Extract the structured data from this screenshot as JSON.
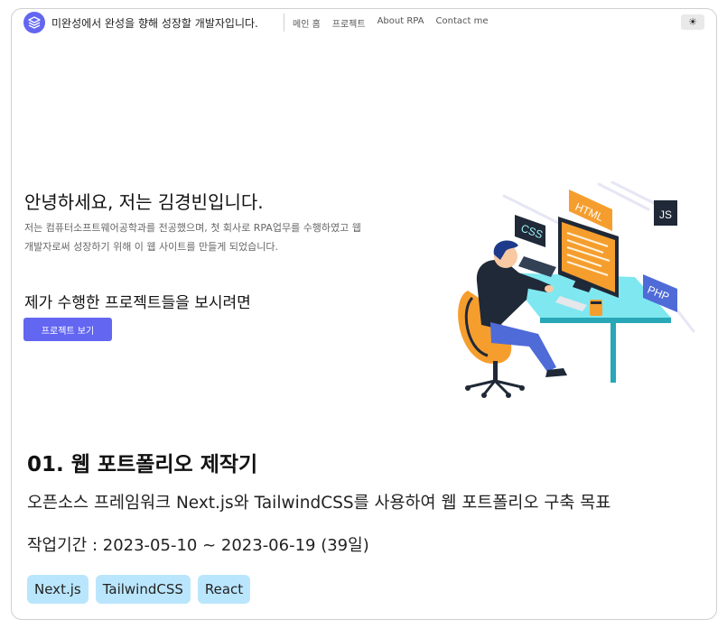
{
  "header": {
    "site_title": "미완성에서 완성을 향해 성장할 개발자입니다.",
    "nav": [
      {
        "label": "메인 홈"
      },
      {
        "label": "프로젝트"
      },
      {
        "label": "About RPA"
      },
      {
        "label": "Contact me"
      }
    ],
    "theme_icon": "sun-icon",
    "theme_glyph": "☀"
  },
  "hero": {
    "heading": "안녕하세요, 저는 김경빈입니다.",
    "description": "저는 컴퓨터소프트웨어공학과를 전공했으며, 첫 회사로 RPA업무를 수행하였고 웹 개발자로써 성장하기 위해 이 웹 사이트를 만들게 되었습니다.",
    "subheading": "제가 수행한 프로젝트들을 보시려면",
    "button_label": "프로젝트 보기",
    "illustration_labels": {
      "html": "HTML",
      "js": "JS",
      "css": "CSS",
      "php": "PHP"
    }
  },
  "project": {
    "title": "01. 웹 포트폴리오 제작기",
    "description": "오픈소스 프레임워크 Next.js와 TailwindCSS를 사용하여 웹 포트폴리오 구축 목표",
    "period": "작업기간 : 2023-05-10 ~ 2023-06-19 (39일)",
    "tags": [
      "Next.js",
      "TailwindCSS",
      "React"
    ]
  },
  "colors": {
    "accent": "#6366f1",
    "tag_bg": "#bae6fd",
    "chair": "#f59e2e",
    "desk": "#7fe7f0"
  }
}
